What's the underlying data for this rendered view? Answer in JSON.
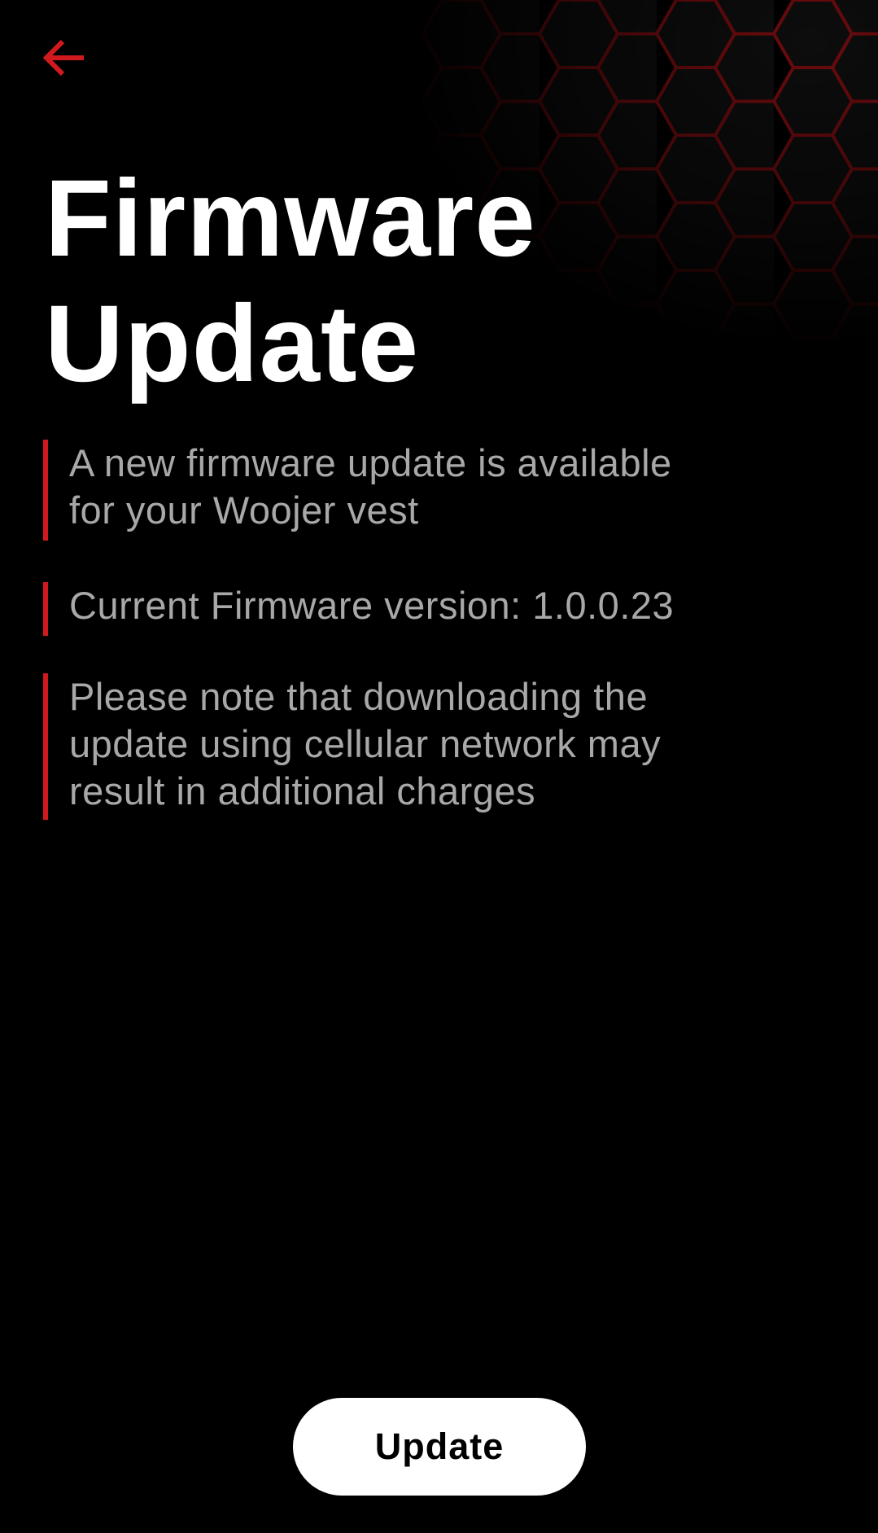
{
  "header": {
    "back_icon": "arrow-left-icon",
    "accent_color": "#d01a1e"
  },
  "title": {
    "line1": "Firmware",
    "line2": "Update"
  },
  "notes": [
    {
      "line1": "A new firmware update is available",
      "line2": "for your Woojer vest"
    },
    {
      "line1": "Current Firmware version: 1.0.0.23"
    },
    {
      "line1": "Please note that downloading the",
      "line2": "update using cellular network may",
      "line3": "result in additional charges"
    }
  ],
  "actions": {
    "update_label": "Update"
  }
}
